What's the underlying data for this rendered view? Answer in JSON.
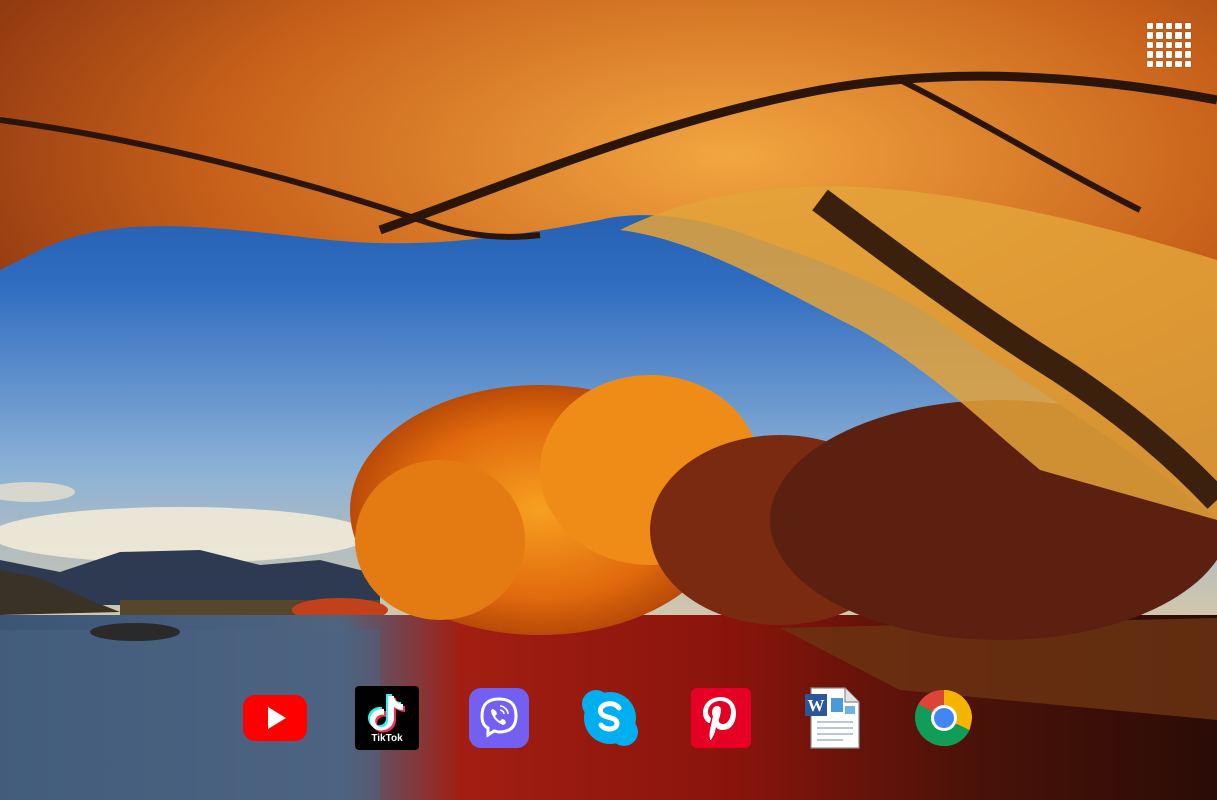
{
  "desktop": {
    "apps_button": {
      "icon": "grid-icon"
    },
    "dock": {
      "items": [
        {
          "id": "youtube",
          "icon": "youtube-icon",
          "color": "#ff0000"
        },
        {
          "id": "tiktok",
          "icon": "tiktok-icon",
          "label": "TikTok",
          "color": "#010101"
        },
        {
          "id": "viber",
          "icon": "viber-icon",
          "color": "#7360f2"
        },
        {
          "id": "skype",
          "icon": "skype-icon",
          "color": "#00aff0"
        },
        {
          "id": "pinterest",
          "icon": "pinterest-icon",
          "color": "#e60023"
        },
        {
          "id": "word",
          "icon": "word-document-icon",
          "color": "#2b579a"
        },
        {
          "id": "chrome",
          "icon": "chrome-icon",
          "color": "#4285f4"
        }
      ]
    }
  }
}
